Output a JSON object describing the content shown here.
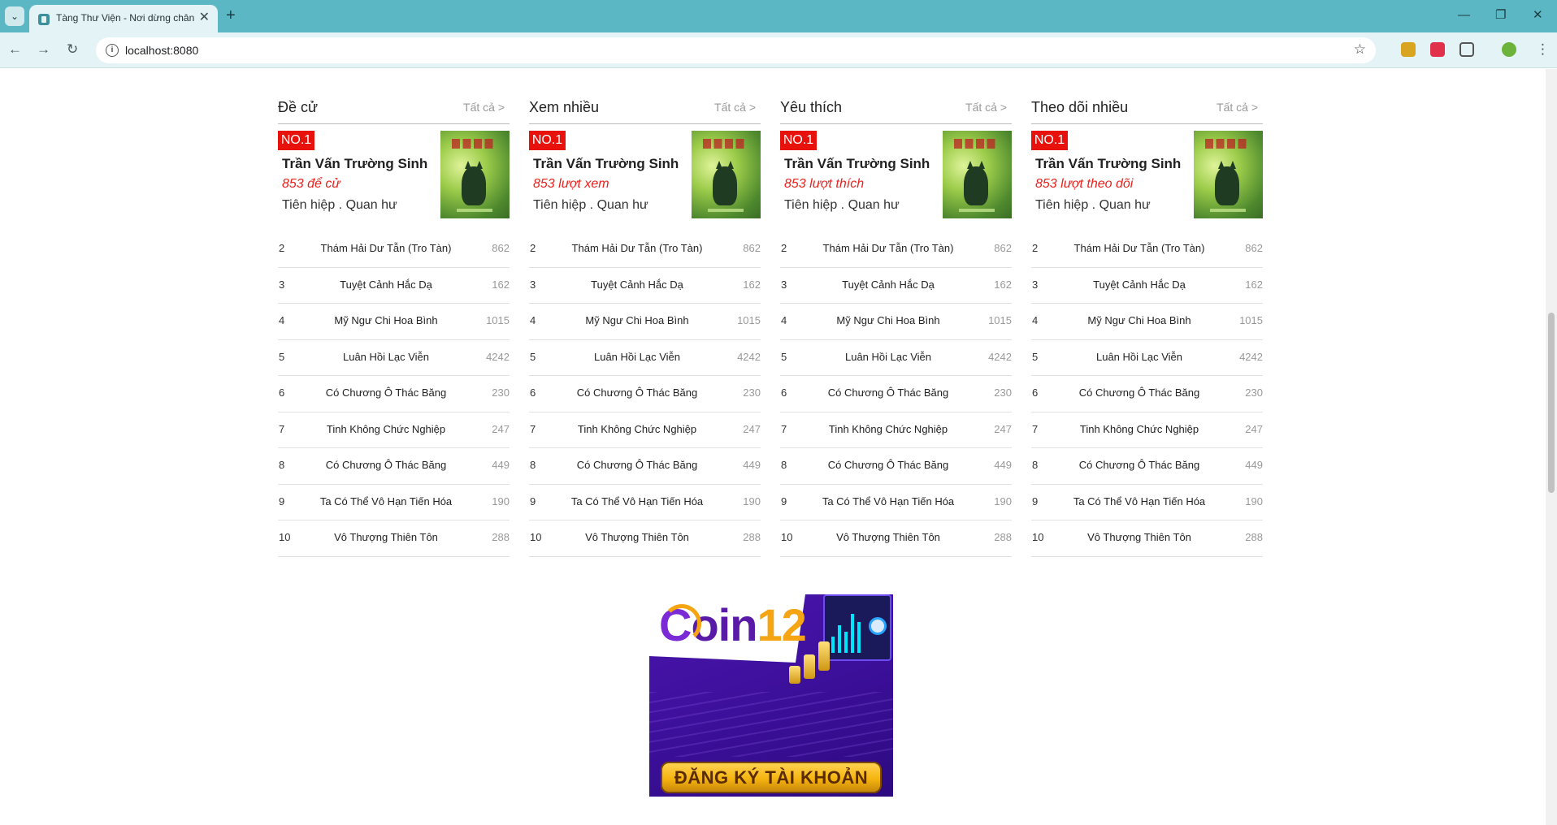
{
  "browser": {
    "tab_title": "Tàng Thư Viện - Nơi dừng chân",
    "url": "localhost:8080",
    "tab_close": "✕",
    "new_tab": "+",
    "back_icon": "←",
    "forward_icon": "→",
    "reload_icon": "↻",
    "star_icon": "☆",
    "minimize": "—",
    "maximize": "❐",
    "close": "✕"
  },
  "columns": [
    {
      "title": "Đề cử",
      "more": "Tất cả >",
      "top": {
        "badge": "NO.1",
        "name": "Trần Vấn Trường Sinh",
        "stat": "853 để cử",
        "genre": "Tiên hiệp . Quan hư"
      },
      "items": [
        {
          "rank": "2",
          "name": "Thám Hải Dư Tẫn (Tro Tàn)",
          "count": "862"
        },
        {
          "rank": "3",
          "name": "Tuyệt Cảnh Hắc Dạ",
          "count": "162"
        },
        {
          "rank": "4",
          "name": "Mỹ Ngư Chi Hoa Bình",
          "count": "1015"
        },
        {
          "rank": "5",
          "name": "Luân Hồi Lạc Viễn",
          "count": "4242"
        },
        {
          "rank": "6",
          "name": "Có Chương Ô Thác Băng",
          "count": "230"
        },
        {
          "rank": "7",
          "name": "Tinh Không Chức Nghiệp",
          "count": "247"
        },
        {
          "rank": "8",
          "name": "Có Chương Ô Thác Băng",
          "count": "449"
        },
        {
          "rank": "9",
          "name": "Ta Có Thể Vô Hạn Tiến Hóa",
          "count": "190"
        },
        {
          "rank": "10",
          "name": "Vô Thượng Thiên Tôn",
          "count": "288"
        }
      ]
    },
    {
      "title": "Xem nhiều",
      "more": "Tất cả >",
      "top": {
        "badge": "NO.1",
        "name": "Trần Vấn Trường Sinh",
        "stat": "853 lượt xem",
        "genre": "Tiên hiệp . Quan hư"
      },
      "items": [
        {
          "rank": "2",
          "name": "Thám Hải Dư Tẫn (Tro Tàn)",
          "count": "862"
        },
        {
          "rank": "3",
          "name": "Tuyệt Cảnh Hắc Dạ",
          "count": "162"
        },
        {
          "rank": "4",
          "name": "Mỹ Ngư Chi Hoa Bình",
          "count": "1015"
        },
        {
          "rank": "5",
          "name": "Luân Hồi Lạc Viễn",
          "count": "4242"
        },
        {
          "rank": "6",
          "name": "Có Chương Ô Thác Băng",
          "count": "230"
        },
        {
          "rank": "7",
          "name": "Tinh Không Chức Nghiệp",
          "count": "247"
        },
        {
          "rank": "8",
          "name": "Có Chương Ô Thác Băng",
          "count": "449"
        },
        {
          "rank": "9",
          "name": "Ta Có Thể Vô Hạn Tiến Hóa",
          "count": "190"
        },
        {
          "rank": "10",
          "name": "Vô Thượng Thiên Tôn",
          "count": "288"
        }
      ]
    },
    {
      "title": "Yêu thích",
      "more": "Tất cả >",
      "top": {
        "badge": "NO.1",
        "name": "Trần Vấn Trường Sinh",
        "stat": "853 lượt thích",
        "genre": "Tiên hiệp . Quan hư"
      },
      "items": [
        {
          "rank": "2",
          "name": "Thám Hải Dư Tẫn (Tro Tàn)",
          "count": "862"
        },
        {
          "rank": "3",
          "name": "Tuyệt Cảnh Hắc Dạ",
          "count": "162"
        },
        {
          "rank": "4",
          "name": "Mỹ Ngư Chi Hoa Bình",
          "count": "1015"
        },
        {
          "rank": "5",
          "name": "Luân Hồi Lạc Viễn",
          "count": "4242"
        },
        {
          "rank": "6",
          "name": "Có Chương Ô Thác Băng",
          "count": "230"
        },
        {
          "rank": "7",
          "name": "Tinh Không Chức Nghiệp",
          "count": "247"
        },
        {
          "rank": "8",
          "name": "Có Chương Ô Thác Băng",
          "count": "449"
        },
        {
          "rank": "9",
          "name": "Ta Có Thể Vô Hạn Tiến Hóa",
          "count": "190"
        },
        {
          "rank": "10",
          "name": "Vô Thượng Thiên Tôn",
          "count": "288"
        }
      ]
    },
    {
      "title": "Theo dõi nhiều",
      "more": "Tất cả >",
      "top": {
        "badge": "NO.1",
        "name": "Trần Vấn Trường Sinh",
        "stat": "853 lượt theo dõi",
        "genre": "Tiên hiệp . Quan hư"
      },
      "items": [
        {
          "rank": "2",
          "name": "Thám Hải Dư Tẫn (Tro Tàn)",
          "count": "862"
        },
        {
          "rank": "3",
          "name": "Tuyệt Cảnh Hắc Dạ",
          "count": "162"
        },
        {
          "rank": "4",
          "name": "Mỹ Ngư Chi Hoa Bình",
          "count": "1015"
        },
        {
          "rank": "5",
          "name": "Luân Hồi Lạc Viễn",
          "count": "4242"
        },
        {
          "rank": "6",
          "name": "Có Chương Ô Thác Băng",
          "count": "230"
        },
        {
          "rank": "7",
          "name": "Tinh Không Chức Nghiệp",
          "count": "247"
        },
        {
          "rank": "8",
          "name": "Có Chương Ô Thác Băng",
          "count": "449"
        },
        {
          "rank": "9",
          "name": "Ta Có Thể Vô Hạn Tiến Hóa",
          "count": "190"
        },
        {
          "rank": "10",
          "name": "Vô Thượng Thiên Tôn",
          "count": "288"
        }
      ]
    }
  ],
  "ad": {
    "logo_c": "C",
    "logo_rest": "oin",
    "logo_num": "12",
    "cta": "ĐĂNG KÝ TÀI KHOẢN"
  },
  "colors": {
    "tab_bar": "#5bb7c3",
    "badge": "#e8120d",
    "stat_text": "#e8221d",
    "ad_purple": "#3b0f98",
    "ad_gold": "#f5b40f"
  }
}
